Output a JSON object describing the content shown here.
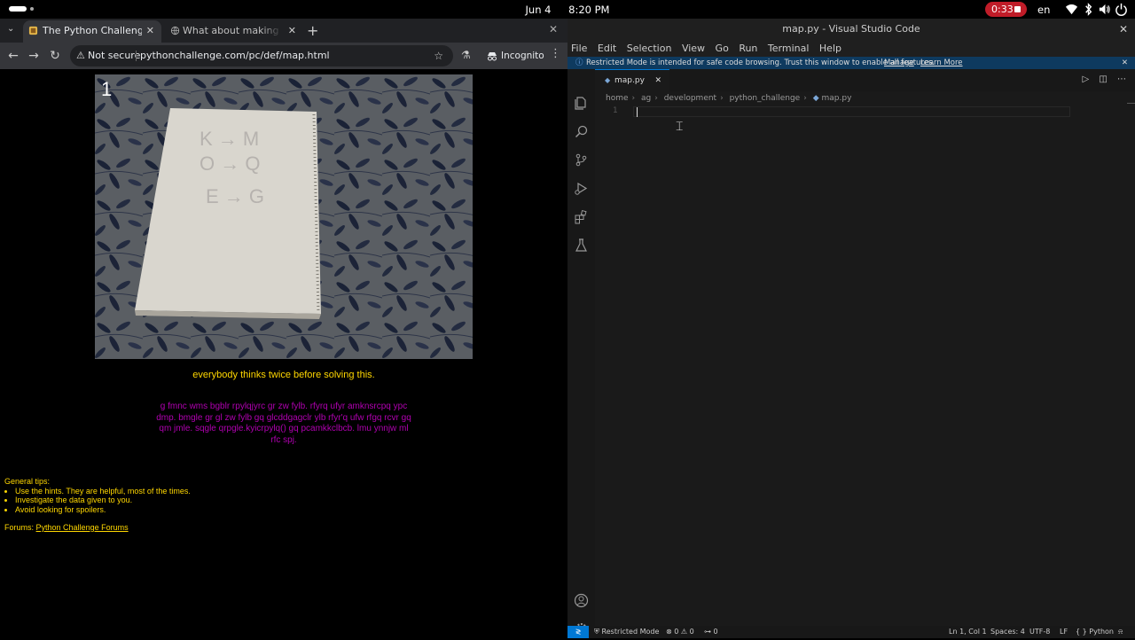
{
  "topbar": {
    "date": "Jun 4",
    "time": "8:20 PM",
    "recording": "0:33",
    "language": "en"
  },
  "chrome": {
    "tabs": [
      {
        "title": "The Python Challenge"
      },
      {
        "title": "What about making trans"
      }
    ],
    "not_secure": "Not secure",
    "url": "pythonchallenge.com/pc/def/map.html",
    "incognito": "Incognito"
  },
  "page": {
    "photo_number": "1",
    "photo_lines": [
      "K → M",
      "O → Q",
      "E → G"
    ],
    "caption": "everybody thinks twice before solving this.",
    "cipher_lines": [
      "g fmnc wms bgblr rpylqjyrc gr zw fylb. rfyrq ufyr amknsrcpq ypc",
      "dmp. bmgle gr gl zw fylb gq glcddgagclr ylb rfyr'q ufw rfgq rcvr gq",
      "qm jmle. sqgle qrpgle.kyicrpylq() gq pcamkkclbcb. lmu ynnjw ml",
      "rfc spj."
    ],
    "tips_heading": "General tips:",
    "tips": [
      "Use the hints. They are helpful, most of the times.",
      "Investigate the data given to you.",
      "Avoid looking for spoilers."
    ],
    "forums_label": "Forums:",
    "forums_link": "Python Challenge Forums"
  },
  "vscode": {
    "title": "map.py - Visual Studio Code",
    "menu": [
      "File",
      "Edit",
      "Selection",
      "View",
      "Go",
      "Run",
      "Terminal",
      "Help"
    ],
    "banner": {
      "message": "Restricted Mode is intended for safe code browsing. Trust this window to enable all features.",
      "manage": "Manage",
      "learn_more": "Learn More"
    },
    "tab": "map.py",
    "breadcrumb": [
      "home",
      "ag",
      "development",
      "python_challenge",
      "map.py"
    ],
    "line_number": "1",
    "status": {
      "restricted": "Restricted Mode",
      "problems": "⊗ 0 ⚠ 0",
      "ports": "0",
      "position": "Ln 1, Col 1",
      "spaces": "Spaces: 4",
      "encoding": "UTF-8",
      "eol": "LF",
      "language": "Python"
    }
  }
}
